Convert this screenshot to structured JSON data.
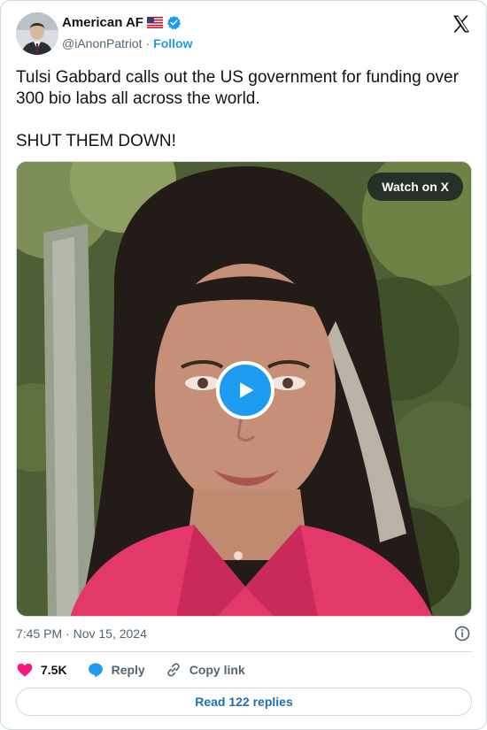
{
  "author": {
    "name": "American AF",
    "handle": "@iAnonPatriot",
    "follow_label": "Follow"
  },
  "tweet": {
    "text": "Tulsi Gabbard calls out the US government for funding over 300 bio labs all across the world.\n\nSHUT THEM DOWN!"
  },
  "media": {
    "watch_label": "Watch on X"
  },
  "meta": {
    "timestamp": "7:45 PM · Nov 15, 2024"
  },
  "actions": {
    "like_count": "7.5K",
    "reply_label": "Reply",
    "copy_label": "Copy link"
  },
  "footer": {
    "read_replies_label": "Read 122 replies"
  },
  "colors": {
    "accent": "#1d9bf0",
    "like": "#f91880",
    "text_secondary": "#536471",
    "border": "#cfd9de"
  },
  "icons": [
    "flag-icon",
    "verified-icon",
    "x-logo-icon",
    "play-icon",
    "info-icon",
    "heart-icon",
    "reply-icon",
    "link-icon"
  ]
}
